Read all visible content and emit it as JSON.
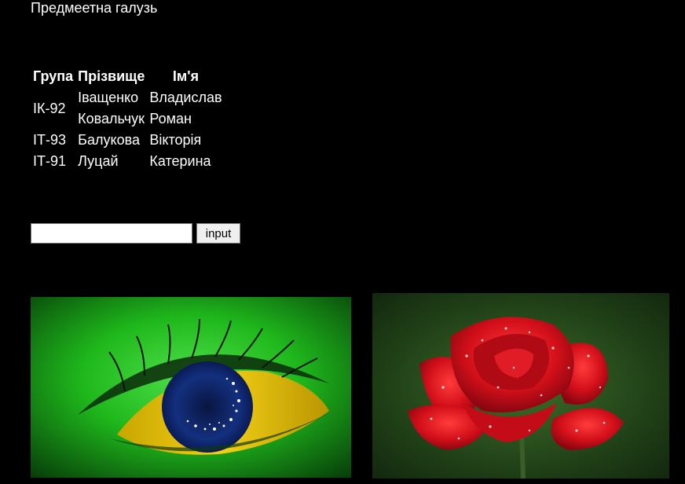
{
  "page": {
    "title": "Предмеетна галузь"
  },
  "table": {
    "headers": [
      "Група",
      "Прізвище",
      "Ім'я"
    ],
    "rows": [
      {
        "group": "ІК-92",
        "surname": "Іващенко",
        "name": "Владислав"
      },
      {
        "group": "",
        "surname": "Ковальчук",
        "name": "Роман"
      },
      {
        "group": "ІТ-93",
        "surname": "Балукова",
        "name": "Вікторія"
      },
      {
        "group": "ІТ-91",
        "surname": "Луцай",
        "name": "Катерина"
      }
    ]
  },
  "form": {
    "input_value": "",
    "input_placeholder": "",
    "button_label": "input"
  },
  "images": [
    {
      "subject": "green eye with yellow and blue iris"
    },
    {
      "subject": "red rose with water droplets"
    }
  ]
}
